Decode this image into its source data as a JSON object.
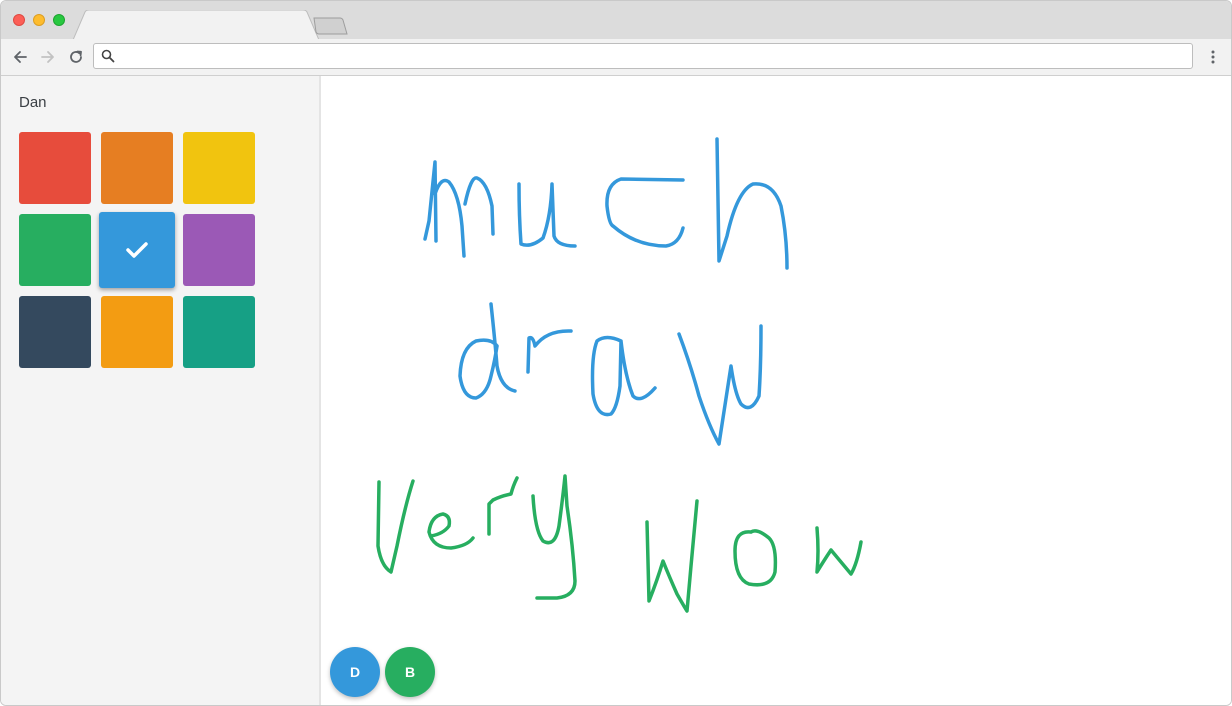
{
  "browser": {
    "address_value": "",
    "address_placeholder": ""
  },
  "sidebar": {
    "user_name": "Dan",
    "palette": [
      {
        "name": "red",
        "color": "#e74c3c",
        "selected": false
      },
      {
        "name": "carrot-orange",
        "color": "#e67e22",
        "selected": false
      },
      {
        "name": "sunflower-yellow",
        "color": "#f1c40f",
        "selected": false
      },
      {
        "name": "green",
        "color": "#27ae60",
        "selected": false
      },
      {
        "name": "blue",
        "color": "#3498db",
        "selected": true
      },
      {
        "name": "purple",
        "color": "#9b59b6",
        "selected": false
      },
      {
        "name": "dark-navy",
        "color": "#34495e",
        "selected": false
      },
      {
        "name": "orange",
        "color": "#f39c12",
        "selected": false
      },
      {
        "name": "teal",
        "color": "#16a085",
        "selected": false
      }
    ],
    "selected_icon": "checkmark-icon"
  },
  "canvas": {
    "stroke_colors": {
      "blue": "#3498db",
      "green": "#27ae60"
    },
    "users": [
      {
        "initial": "D",
        "color": "#3498db"
      },
      {
        "initial": "B",
        "color": "#27ae60"
      }
    ]
  },
  "icons": {
    "back": "arrow-left-icon",
    "forward": "arrow-right-icon",
    "reload": "reload-icon",
    "search": "search-icon",
    "menu": "vertical-dots-icon"
  }
}
